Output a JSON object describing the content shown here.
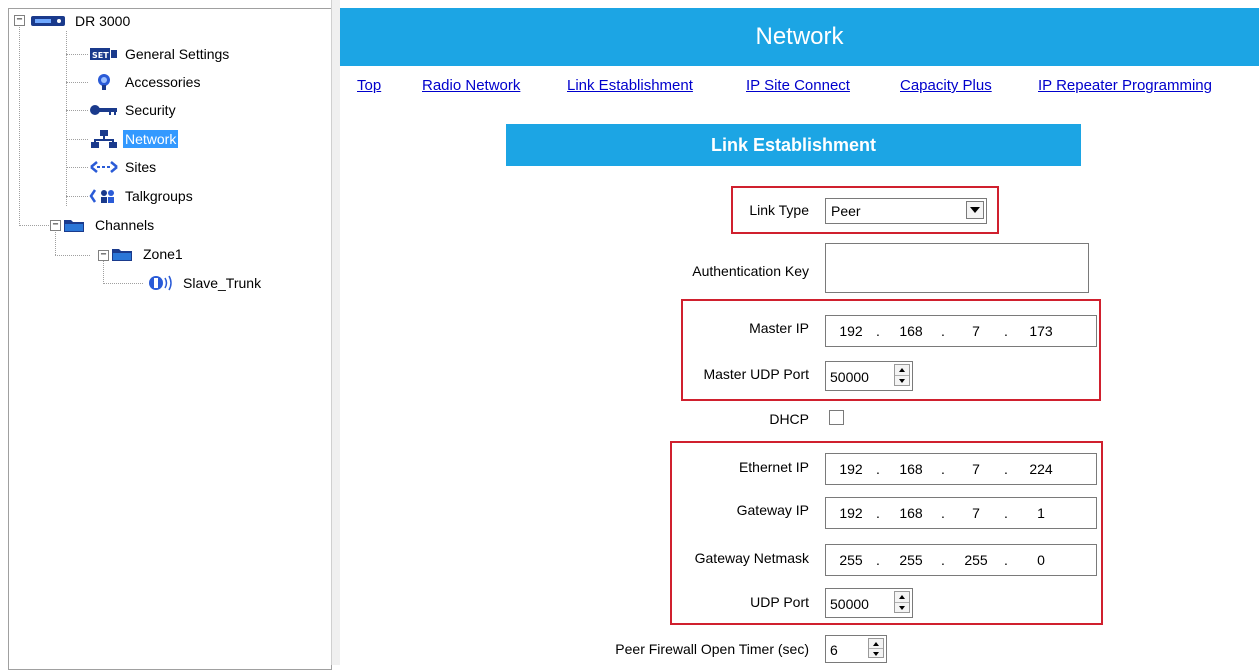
{
  "tree": {
    "root": "DR 3000",
    "items": [
      {
        "label": "General Settings",
        "icon": "settings-icon"
      },
      {
        "label": "Accessories",
        "icon": "accessories-icon"
      },
      {
        "label": "Security",
        "icon": "key-icon"
      },
      {
        "label": "Network",
        "icon": "network-icon",
        "selected": true
      },
      {
        "label": "Sites",
        "icon": "sites-icon"
      },
      {
        "label": "Talkgroups",
        "icon": "talkgroups-icon"
      },
      {
        "label": "Channels",
        "icon": "folder-icon"
      },
      {
        "label": "Zone1",
        "icon": "folder-icon"
      },
      {
        "label": "Slave_Trunk",
        "icon": "channel-icon"
      }
    ],
    "settings_badge": "SET"
  },
  "header": {
    "title": "Network"
  },
  "nav": {
    "links": [
      "Top",
      "Radio Network",
      "Link Establishment",
      "IP Site Connect",
      "Capacity Plus",
      "IP Repeater Programming"
    ]
  },
  "section": {
    "title": "Link Establishment"
  },
  "form": {
    "link_type": {
      "label": "Link Type",
      "value": "Peer"
    },
    "auth_key": {
      "label": "Authentication Key",
      "value": ""
    },
    "master_ip": {
      "label": "Master IP",
      "octets": [
        "192",
        "168",
        "7",
        "173"
      ]
    },
    "master_udp_port": {
      "label": "Master UDP Port",
      "value": "50000"
    },
    "dhcp": {
      "label": "DHCP",
      "checked": false
    },
    "ethernet_ip": {
      "label": "Ethernet IP",
      "octets": [
        "192",
        "168",
        "7",
        "224"
      ]
    },
    "gateway_ip": {
      "label": "Gateway IP",
      "octets": [
        "192",
        "168",
        "7",
        "1"
      ]
    },
    "gateway_netmask": {
      "label": "Gateway Netmask",
      "octets": [
        "255",
        "255",
        "255",
        "0"
      ]
    },
    "udp_port": {
      "label": "UDP Port",
      "value": "50000"
    },
    "peer_firewall": {
      "label": "Peer Firewall Open Timer (sec)",
      "value": "6"
    }
  },
  "colors": {
    "accent": "#1ca5e4",
    "highlight": "#d0202e",
    "link": "#0000cc",
    "selection": "#3399ff"
  }
}
